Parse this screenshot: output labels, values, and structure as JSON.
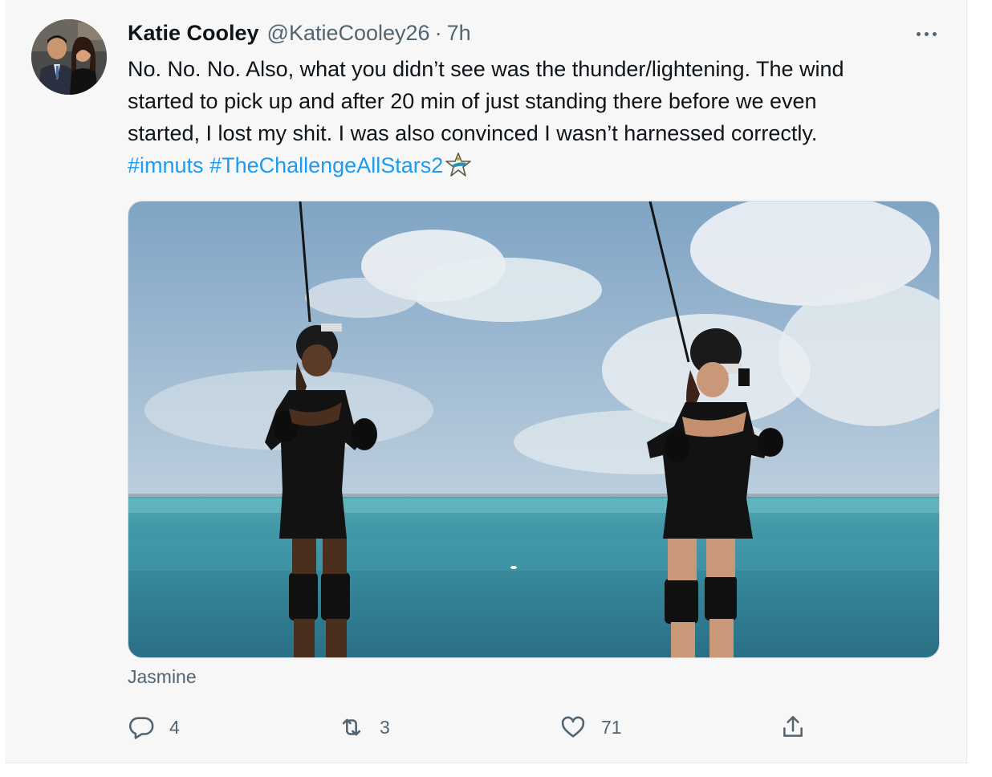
{
  "tweet": {
    "author": {
      "name": "Katie Cooley",
      "handle": "@KatieCooley26",
      "separator": "·",
      "time": "7h"
    },
    "body": {
      "line1": "No. No. No. Also, what you didn’t see was the thunder/lightening. The wind",
      "line2": "started to pick up and after 20 min of just standing there before we even",
      "line3": "started, I lost my shit. I was also convinced I wasn’t harnessed correctly.",
      "hashtags": [
        "#imnuts",
        "#TheChallengeAllStars2"
      ]
    },
    "media": {
      "alt_caption": "Jasmine"
    },
    "actions": {
      "reply_count": "4",
      "retweet_count": "3",
      "like_count": "71"
    },
    "icons": {
      "more": "more-icon",
      "reply": "reply-icon",
      "retweet": "retweet-icon",
      "like": "heart-icon",
      "share": "share-icon",
      "hashflag": "star-hashflag-icon"
    },
    "colors": {
      "link": "#1d9bf0",
      "secondary_text": "#536471",
      "primary_text": "#0f1419",
      "background": "#f7f7f7"
    }
  }
}
